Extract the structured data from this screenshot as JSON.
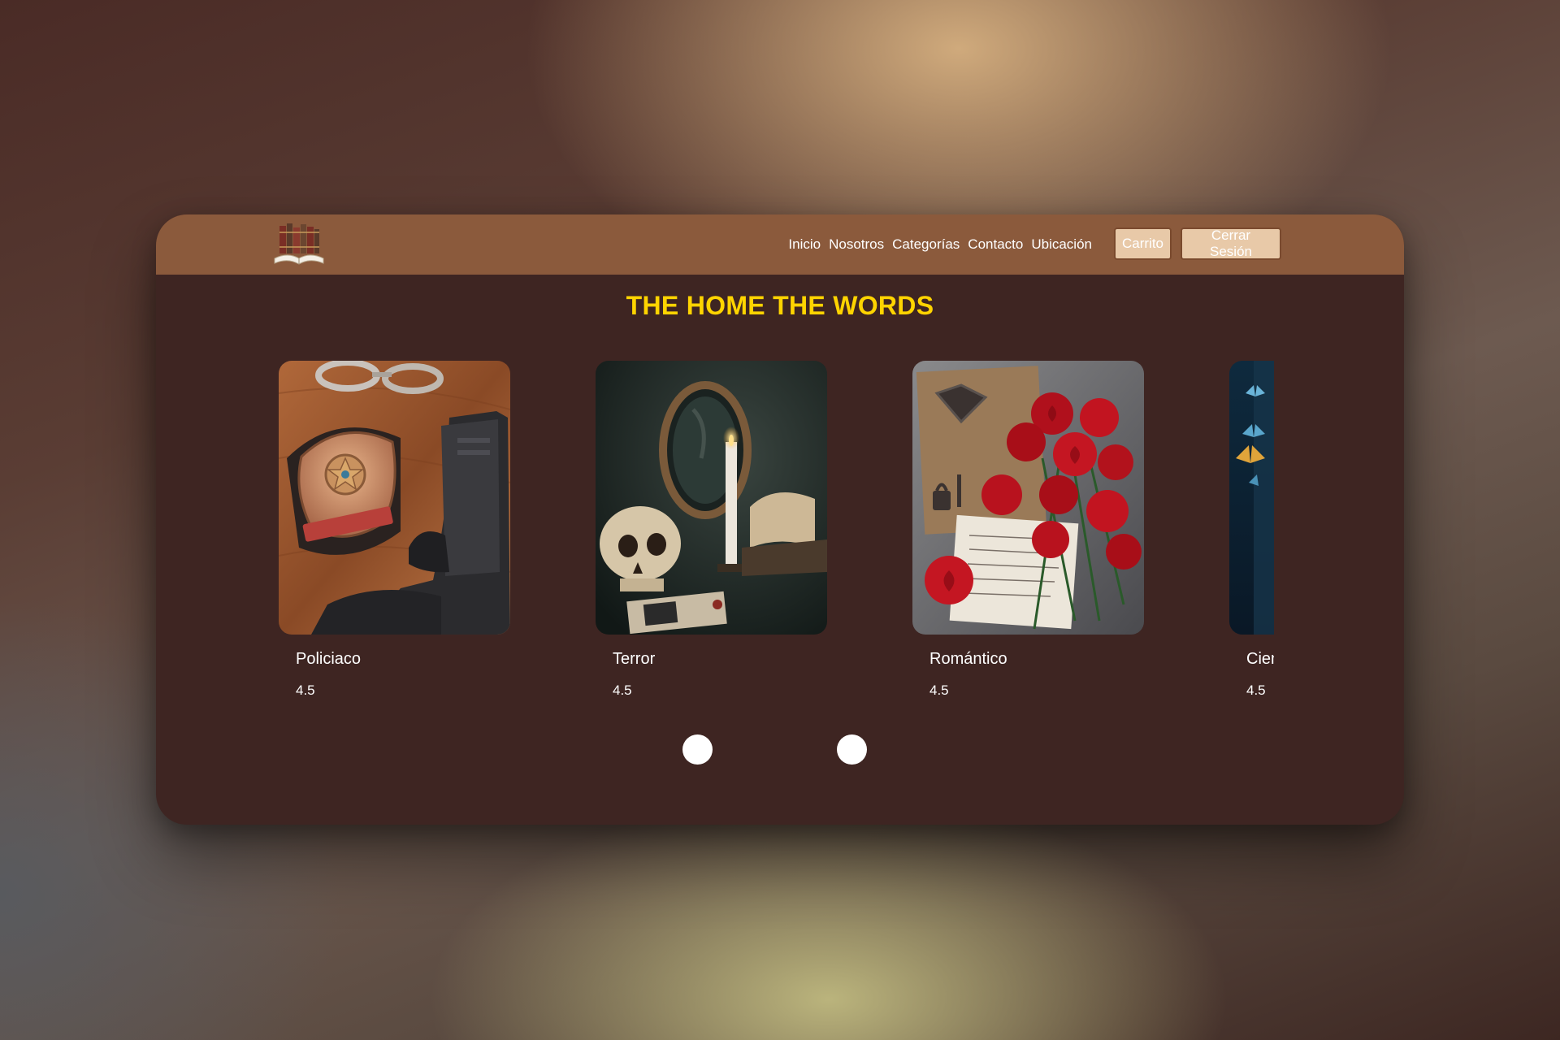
{
  "navbar": {
    "logo_icon": "books-logo-icon",
    "links": [
      "Inicio",
      "Nosotros",
      "Categorías",
      "Contacto",
      "Ubicación"
    ],
    "cart_button": "Carrito",
    "logout_button": "Cerrar Sesión",
    "background_color": "#8b5a3c",
    "button_color": "#e8c9a8"
  },
  "main": {
    "title": "THE HOME THE WORDS",
    "title_color": "#ffd400",
    "background_color": "#3e2522",
    "categories": [
      {
        "name": "Policiaco",
        "rating": "4.5",
        "image_icon": "police-badge-pistol-image"
      },
      {
        "name": "Terror",
        "rating": "4.5",
        "image_icon": "skull-candle-mirror-image"
      },
      {
        "name": "Romántico",
        "rating": "4.5",
        "image_icon": "red-roses-letters-image"
      },
      {
        "name": "Ciencia",
        "rating": "4.5",
        "image_icon": "butterflies-night-image"
      }
    ],
    "carousel_dots": 2
  }
}
